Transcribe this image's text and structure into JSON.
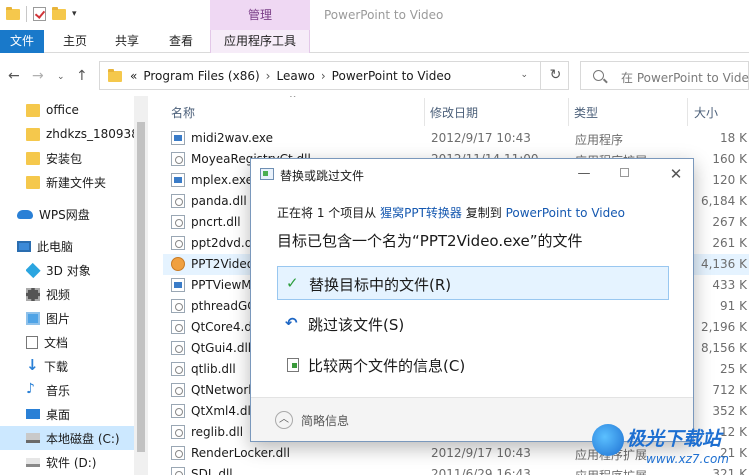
{
  "window": {
    "title": "PowerPoint to Video",
    "manage_tab": "管理"
  },
  "ribbon": {
    "tabs": [
      "文件",
      "主页",
      "共享",
      "查看",
      "应用程序工具"
    ]
  },
  "address": {
    "overflow": "«",
    "crumbs": [
      "Program Files (x86)",
      "Leawo",
      "PowerPoint to Video"
    ],
    "separator": "›",
    "search_placeholder": "在 PowerPoint to Video"
  },
  "sidebar": {
    "items": [
      {
        "label": "office",
        "icon": "folder-icon"
      },
      {
        "label": "zhdkzs_180938",
        "icon": "folder-icon"
      },
      {
        "label": "安装包",
        "icon": "folder-icon"
      },
      {
        "label": "新建文件夹",
        "icon": "folder-icon"
      },
      {
        "label": "WPS网盘",
        "icon": "cloud-icon"
      },
      {
        "label": "此电脑",
        "icon": "computer-icon"
      },
      {
        "label": "3D 对象",
        "icon": "3d-objects-icon"
      },
      {
        "label": "视频",
        "icon": "video-icon"
      },
      {
        "label": "图片",
        "icon": "pictures-icon"
      },
      {
        "label": "文档",
        "icon": "documents-icon"
      },
      {
        "label": "下载",
        "icon": "download-icon"
      },
      {
        "label": "音乐",
        "icon": "music-icon"
      },
      {
        "label": "桌面",
        "icon": "desktop-icon"
      },
      {
        "label": "本地磁盘 (C:)",
        "icon": "local-disk-icon"
      },
      {
        "label": "软件 (D:)",
        "icon": "drive-icon"
      }
    ]
  },
  "filelist": {
    "columns": [
      "名称",
      "修改日期",
      "类型",
      "大小"
    ],
    "rows": [
      {
        "name": "midi2wav.exe",
        "date": "2012/9/17 10:43",
        "type": "应用程序",
        "size": "18 K"
      },
      {
        "name": "MoyeaRegistryCt.dll",
        "date": "2012/11/14 11:00",
        "type": "应用程序扩展",
        "size": "160 K"
      },
      {
        "name": "mplex.exe",
        "date": "",
        "type": "",
        "size": "120 K"
      },
      {
        "name": "panda.dll",
        "date": "",
        "type": "",
        "size": "6,184 K"
      },
      {
        "name": "pncrt.dll",
        "date": "",
        "type": "",
        "size": "267 K"
      },
      {
        "name": "ppt2dvd.dll",
        "date": "",
        "type": "",
        "size": "261 K"
      },
      {
        "name": "PPT2Video",
        "date": "",
        "type": "",
        "size": "4,136 K"
      },
      {
        "name": "PPTViewMaster",
        "date": "",
        "type": "",
        "size": "433 K"
      },
      {
        "name": "pthreadGC2.dll",
        "date": "",
        "type": "",
        "size": "91 K"
      },
      {
        "name": "QtCore4.dll",
        "date": "",
        "type": "",
        "size": "2,196 K"
      },
      {
        "name": "QtGui4.dll",
        "date": "",
        "type": "",
        "size": "8,156 K"
      },
      {
        "name": "qtlib.dll",
        "date": "",
        "type": "",
        "size": "25 K"
      },
      {
        "name": "QtNetwork4.dll",
        "date": "",
        "type": "",
        "size": "712 K"
      },
      {
        "name": "QtXml4.dll",
        "date": "",
        "type": "应用程序扩展",
        "size": "352 K"
      },
      {
        "name": "reglib.dll",
        "date": "",
        "type": "",
        "size": "12 K"
      },
      {
        "name": "RenderLocker.dll",
        "date": "2012/9/17 10:43",
        "type": "应用程序扩展",
        "size": "21 K"
      },
      {
        "name": "SDL.dll",
        "date": "2011/6/29 16:43",
        "type": "应用程序扩展",
        "size": "321 K"
      }
    ]
  },
  "dialog": {
    "title": "替换或跳过文件",
    "line1_prefix": "正在将 1 个项目从",
    "line1_source": "猩窝PPT转换器",
    "line1_mid": "复制到",
    "line1_dest": "PowerPoint to Video",
    "heading": "目标已包含一个名为“PPT2Video.exe”的文件",
    "options": [
      "替换目标中的文件(R)",
      "跳过该文件(S)",
      "比较两个文件的信息(C)"
    ],
    "details": "简略信息",
    "close_glyph": "✕"
  },
  "watermark": {
    "main": "极光下载站",
    "url": "www.xz7.com"
  }
}
